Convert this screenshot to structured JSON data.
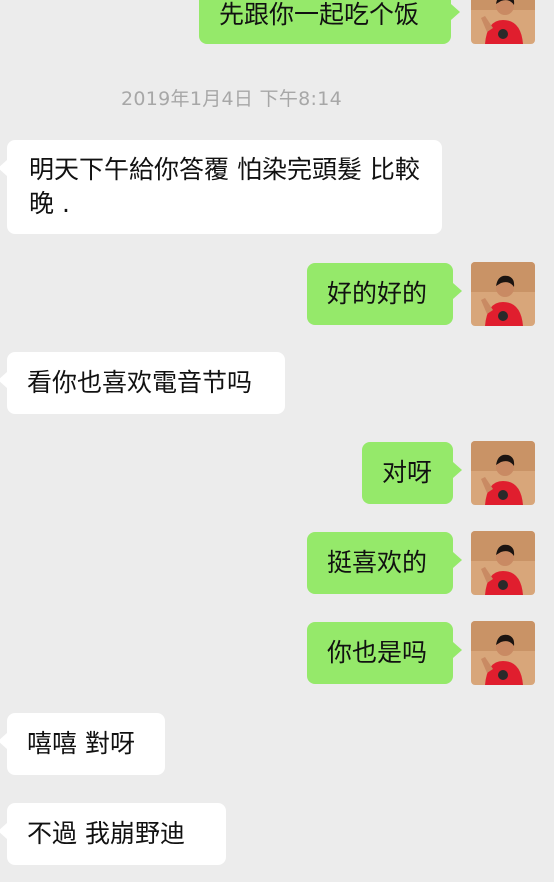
{
  "chat": {
    "timestamp": "2019年1月4日 下午8:14",
    "messages": [
      {
        "side": "out",
        "text": "先跟你一起吃个饭"
      },
      {
        "side": "in",
        "text": "明天下午給你答覆 怕染完頭髮 比較晚 ."
      },
      {
        "side": "out",
        "text": "好的好的"
      },
      {
        "side": "in",
        "text": "看你也喜欢電音节吗"
      },
      {
        "side": "out",
        "text": "对呀"
      },
      {
        "side": "out",
        "text": "挺喜欢的"
      },
      {
        "side": "out",
        "text": "你也是吗"
      },
      {
        "side": "in",
        "text": "嘻嘻 對呀"
      },
      {
        "side": "in",
        "text": "不過 我崩野迪"
      }
    ]
  },
  "colors": {
    "background": "#ececec",
    "incoming_bubble": "#ffffff",
    "outgoing_bubble": "#95e96a",
    "timestamp_text": "#a7a7a7"
  },
  "icons": {
    "avatar": "user-avatar-photo"
  }
}
